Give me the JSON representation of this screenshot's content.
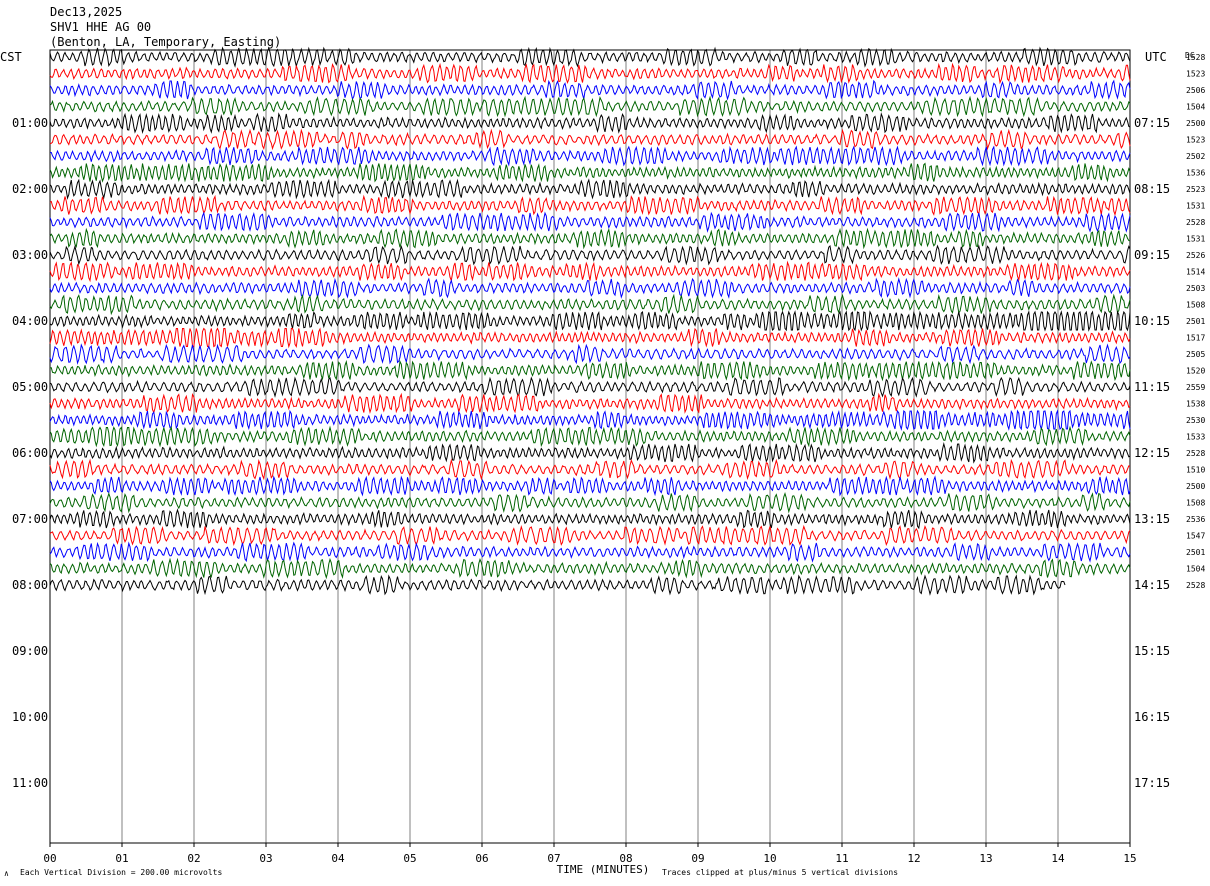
{
  "header": {
    "date": "Dec13,2025",
    "station": "SHV1 HHE AG 00",
    "location": "(Benton, LA, Temporary, Easting)"
  },
  "left_tz": "CST",
  "right_tz": "UTC",
  "dc_header": "DC",
  "left_hour_labels": [
    "01:00",
    "02:00",
    "03:00",
    "04:00",
    "05:00",
    "06:00",
    "07:00",
    "08:00",
    "09:00",
    "10:00",
    "11:00"
  ],
  "right_hour_labels": [
    "07:15",
    "08:15",
    "09:15",
    "10:15",
    "11:15",
    "12:15",
    "13:15",
    "14:15",
    "15:15",
    "16:15",
    "17:15"
  ],
  "x_ticks": [
    "00",
    "01",
    "02",
    "03",
    "04",
    "05",
    "06",
    "07",
    "08",
    "09",
    "10",
    "11",
    "12",
    "13",
    "14",
    "15"
  ],
  "x_label": "TIME (MINUTES)",
  "footer_left": "Each Vertical Division =  200.00 microvolts",
  "footer_right": "Traces clipped at plus/minus 5 vertical divisions",
  "colors": {
    "trace_cycle": [
      "#000000",
      "#ff0000",
      "#0000ff",
      "#006400"
    ],
    "grid": "#808080"
  },
  "chart_data": {
    "type": "line",
    "description_hint": "helicorder",
    "minutes_per_line": 15,
    "lines_total": 36,
    "lines_with_data": 33,
    "last_line_end_minute": 14.1,
    "dc_offsets": [
      "1528",
      "1523",
      "2506",
      "1504",
      "2500",
      "1523",
      "2502",
      "1536",
      "2523",
      "1531",
      "2528",
      "1531",
      "2526",
      "1514",
      "2503",
      "1508",
      "2501",
      "1517",
      "2505",
      "1520",
      "2559",
      "1538",
      "2530",
      "1533",
      "2528",
      "1510",
      "2500",
      "1508",
      "2536",
      "1547",
      "2501",
      "1504",
      "2528"
    ]
  }
}
